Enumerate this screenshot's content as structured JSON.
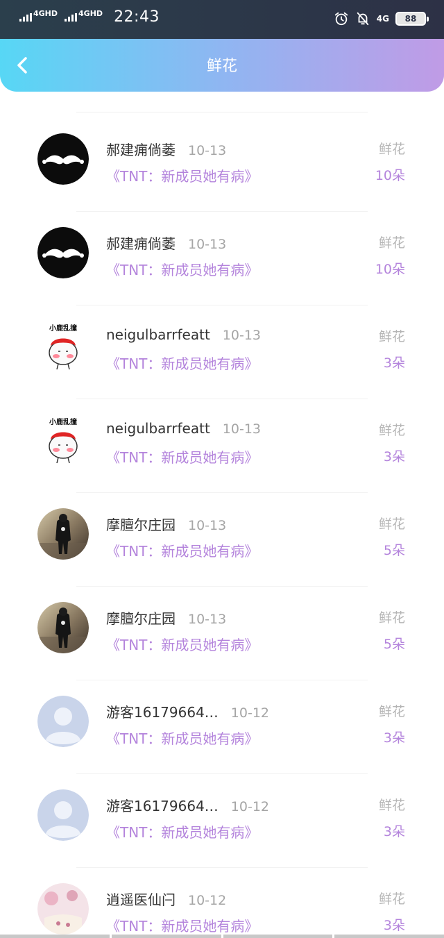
{
  "status_bar": {
    "net1": "4GHD",
    "net2": "4GHD",
    "time": "22:43",
    "net3": "4G",
    "battery": "88"
  },
  "header": {
    "title": "鲜花",
    "back_icon": "chevron-left-icon"
  },
  "rows": [
    {
      "name": "郝建痈倘萎",
      "date": "10-13",
      "work": "《TNT：新成员她有病》",
      "gift": "鲜花",
      "count": "10朵",
      "avatar": "mustache"
    },
    {
      "name": "郝建痈倘萎",
      "date": "10-13",
      "work": "《TNT：新成员她有病》",
      "gift": "鲜花",
      "count": "10朵",
      "avatar": "mustache"
    },
    {
      "name": "neigulbarrfeatt",
      "date": "10-13",
      "work": "《TNT：新成员她有病》",
      "gift": "鲜花",
      "count": "3朵",
      "avatar": "cartoon",
      "avatar_text": "小鹿乱撞"
    },
    {
      "name": "neigulbarrfeatt",
      "date": "10-13",
      "work": "《TNT：新成员她有病》",
      "gift": "鲜花",
      "count": "3朵",
      "avatar": "cartoon",
      "avatar_text": "小鹿乱撞"
    },
    {
      "name": "摩膻尔庄园",
      "date": "10-13",
      "work": "《TNT：新成员她有病》",
      "gift": "鲜花",
      "count": "5朵",
      "avatar": "photo"
    },
    {
      "name": "摩膻尔庄园",
      "date": "10-13",
      "work": "《TNT：新成员她有病》",
      "gift": "鲜花",
      "count": "5朵",
      "avatar": "photo"
    },
    {
      "name": "游客16179664…",
      "date": "10-12",
      "work": "《TNT：新成员她有病》",
      "gift": "鲜花",
      "count": "3朵",
      "avatar": "default"
    },
    {
      "name": "游客16179664…",
      "date": "10-12",
      "work": "《TNT：新成员她有病》",
      "gift": "鲜花",
      "count": "3朵",
      "avatar": "default"
    },
    {
      "name": "逍遥医仙闩",
      "date": "10-12",
      "work": "《TNT：新成员她有病》",
      "gift": "鲜花",
      "count": "3朵",
      "avatar": "pink"
    }
  ]
}
